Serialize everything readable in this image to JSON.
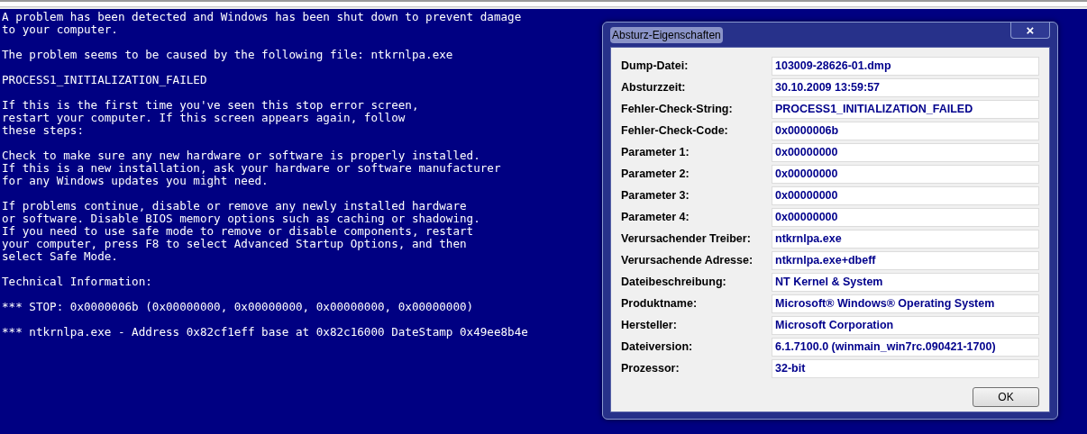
{
  "error_screen": {
    "paragraphs": [
      "A problem has been detected and Windows has been shut down to prevent damage\nto your computer.",
      "The problem seems to be caused by the following file: ntkrnlpa.exe",
      "PROCESS1_INITIALIZATION_FAILED",
      "If this is the first time you've seen this stop error screen,\nrestart your computer. If this screen appears again, follow\nthese steps:",
      "Check to make sure any new hardware or software is properly installed.\nIf this is a new installation, ask your hardware or software manufacturer\nfor any Windows updates you might need.",
      "If problems continue, disable or remove any newly installed hardware\nor software. Disable BIOS memory options such as caching or shadowing.\nIf you need to use safe mode to remove or disable components, restart\nyour computer, press F8 to select Advanced Startup Options, and then\nselect Safe Mode.",
      "Technical Information:",
      "*** STOP: 0x0000006b (0x00000000, 0x00000000, 0x00000000, 0x00000000)",
      "*** ntkrnlpa.exe - Address 0x82cf1eff base at 0x82c16000 DateStamp 0x49ee8b4e"
    ]
  },
  "dialog": {
    "title": "Absturz-Eigenschaften",
    "close_button": "×",
    "rows": [
      {
        "label": "Dump-Datei:",
        "value": "103009-28626-01.dmp"
      },
      {
        "label": "Absturzzeit:",
        "value": "30.10.2009 13:59:57"
      },
      {
        "label": "Fehler-Check-String:",
        "value": "PROCESS1_INITIALIZATION_FAILED"
      },
      {
        "label": "Fehler-Check-Code:",
        "value": "0x0000006b"
      },
      {
        "label": "Parameter 1:",
        "value": "0x00000000"
      },
      {
        "label": "Parameter 2:",
        "value": "0x00000000"
      },
      {
        "label": "Parameter 3:",
        "value": "0x00000000"
      },
      {
        "label": "Parameter 4:",
        "value": "0x00000000"
      },
      {
        "label": "Verursachender Treiber:",
        "value": "ntkrnlpa.exe"
      },
      {
        "label": "Verursachende Adresse:",
        "value": "ntkrnlpa.exe+dbeff"
      },
      {
        "label": "Dateibeschreibung:",
        "value": "NT Kernel & System"
      },
      {
        "label": "Produktname:",
        "value": "Microsoft® Windows® Operating System"
      },
      {
        "label": "Hersteller:",
        "value": "Microsoft Corporation"
      },
      {
        "label": "Dateiversion:",
        "value": "6.1.7100.0 (winmain_win7rc.090421-1700)"
      },
      {
        "label": "Prozessor:",
        "value": "32-bit"
      }
    ],
    "ok_button": "OK"
  }
}
